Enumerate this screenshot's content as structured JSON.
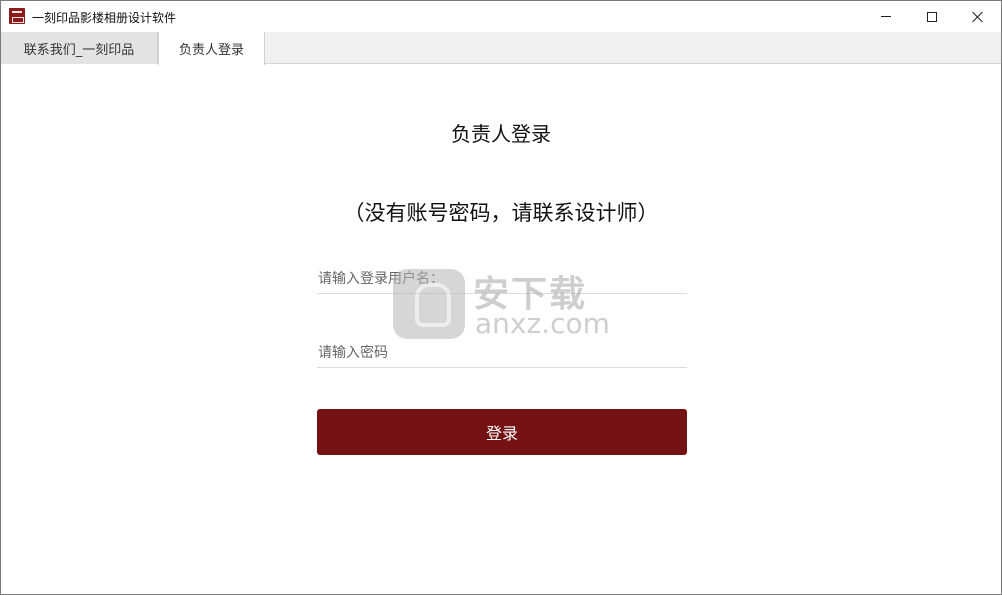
{
  "window": {
    "title": "一刻印品影楼相册设计软件"
  },
  "tabs": [
    {
      "label": "联系我们_一刻印品"
    },
    {
      "label": "负责人登录"
    }
  ],
  "login": {
    "title": "负责人登录",
    "subtitle": "（没有账号密码，请联系设计师）",
    "username_placeholder": "请输入登录用户名：",
    "username_value": "",
    "password_placeholder": "请输入密码",
    "password_value": "",
    "submit_label": "登录"
  },
  "watermark": {
    "cn_text": "安下载",
    "en_text": "anxz.com"
  },
  "colors": {
    "accent": "#731113",
    "tab_bar": "#f0f0f0"
  },
  "icons": {
    "app": "app-logo-icon",
    "minimize": "minimize-icon",
    "maximize": "maximize-icon",
    "close": "close-icon"
  }
}
